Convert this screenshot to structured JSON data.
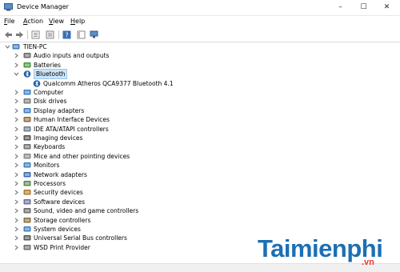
{
  "window": {
    "title": "Device Manager",
    "controls": {
      "minimize": "–",
      "maximize": "☐",
      "close": "✕"
    }
  },
  "menu": {
    "file": {
      "key": "F",
      "rest": "ile"
    },
    "action": {
      "key": "A",
      "rest": "ction"
    },
    "view": {
      "key": "V",
      "rest": "iew"
    },
    "help": {
      "key": "H",
      "rest": "elp"
    }
  },
  "toolbar": [
    "back-icon",
    "forward-icon",
    "properties-icon",
    "show-hide-icon",
    "help-icon",
    "scan-hardware-icon"
  ],
  "tree": {
    "root": "TIEN-PC",
    "items": [
      {
        "label": "Audio inputs and outputs",
        "icon": "speaker-icon",
        "expanded": false
      },
      {
        "label": "Batteries",
        "icon": "battery-icon",
        "expanded": false
      },
      {
        "label": "Bluetooth",
        "icon": "bluetooth-icon",
        "expanded": true,
        "selected": true,
        "children": [
          "Qualcomm Atheros QCA9377 Bluetooth 4.1"
        ]
      },
      {
        "label": "Computer",
        "icon": "computer-icon",
        "expanded": false
      },
      {
        "label": "Disk drives",
        "icon": "disk-icon",
        "expanded": false
      },
      {
        "label": "Display adapters",
        "icon": "display-icon",
        "expanded": false
      },
      {
        "label": "Human Interface Devices",
        "icon": "hid-icon",
        "expanded": false
      },
      {
        "label": "IDE ATA/ATAPI controllers",
        "icon": "ide-icon",
        "expanded": false
      },
      {
        "label": "Imaging devices",
        "icon": "camera-icon",
        "expanded": false
      },
      {
        "label": "Keyboards",
        "icon": "keyboard-icon",
        "expanded": false
      },
      {
        "label": "Mice and other pointing devices",
        "icon": "mouse-icon",
        "expanded": false
      },
      {
        "label": "Monitors",
        "icon": "monitor-icon",
        "expanded": false
      },
      {
        "label": "Network adapters",
        "icon": "network-icon",
        "expanded": false
      },
      {
        "label": "Processors",
        "icon": "processor-icon",
        "expanded": false
      },
      {
        "label": "Security devices",
        "icon": "security-icon",
        "expanded": false
      },
      {
        "label": "Software devices",
        "icon": "software-icon",
        "expanded": false
      },
      {
        "label": "Sound, video and game controllers",
        "icon": "sound-icon",
        "expanded": false
      },
      {
        "label": "Storage controllers",
        "icon": "storage-icon",
        "expanded": false
      },
      {
        "label": "System devices",
        "icon": "system-icon",
        "expanded": false
      },
      {
        "label": "Universal Serial Bus controllers",
        "icon": "usb-icon",
        "expanded": false
      },
      {
        "label": "WSD Print Provider",
        "icon": "printer-icon",
        "expanded": false
      }
    ]
  },
  "watermark": {
    "main": "Taimienphi",
    "tld": ".vn"
  },
  "colors": {
    "selection": "#cce4f7",
    "watermark": "#1c6fb5",
    "watermark_tld": "#e53935"
  }
}
